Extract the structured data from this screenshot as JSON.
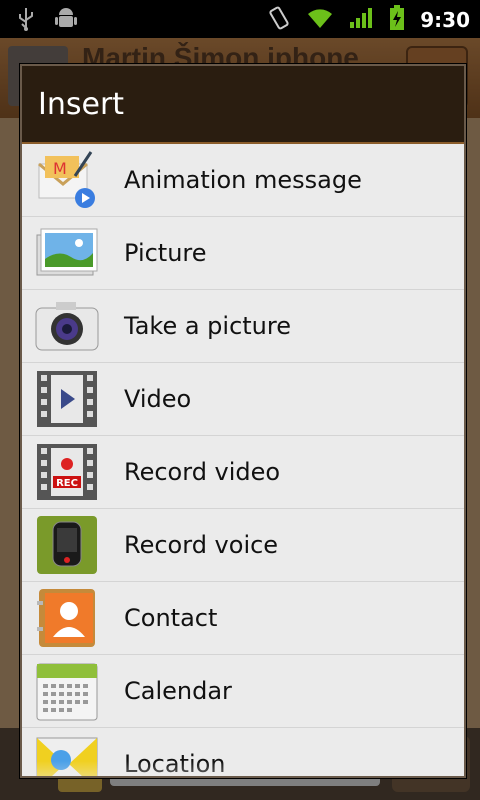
{
  "status_bar": {
    "time": "9:30",
    "icons": [
      "usb-icon",
      "android-debug-icon",
      "vibrate-icon",
      "wifi-icon",
      "signal-icon",
      "battery-charging-icon"
    ]
  },
  "background_app": {
    "contact_name": "Martin Šimon iphone"
  },
  "dialog": {
    "title": "Insert",
    "items": [
      {
        "label": "Animation message",
        "icon": "animation-message-icon"
      },
      {
        "label": "Picture",
        "icon": "picture-icon"
      },
      {
        "label": "Take a picture",
        "icon": "camera-icon"
      },
      {
        "label": "Video",
        "icon": "video-icon"
      },
      {
        "label": "Record video",
        "icon": "record-video-icon"
      },
      {
        "label": "Record voice",
        "icon": "record-voice-icon"
      },
      {
        "label": "Contact",
        "icon": "contact-icon"
      },
      {
        "label": "Calendar",
        "icon": "calendar-icon"
      },
      {
        "label": "Location",
        "icon": "location-icon"
      }
    ],
    "record_video_badge": "REC"
  },
  "colors": {
    "dialog_header": "#2a1d10",
    "list_background": "#ebebeb",
    "accent_wood": "#c2854b"
  }
}
